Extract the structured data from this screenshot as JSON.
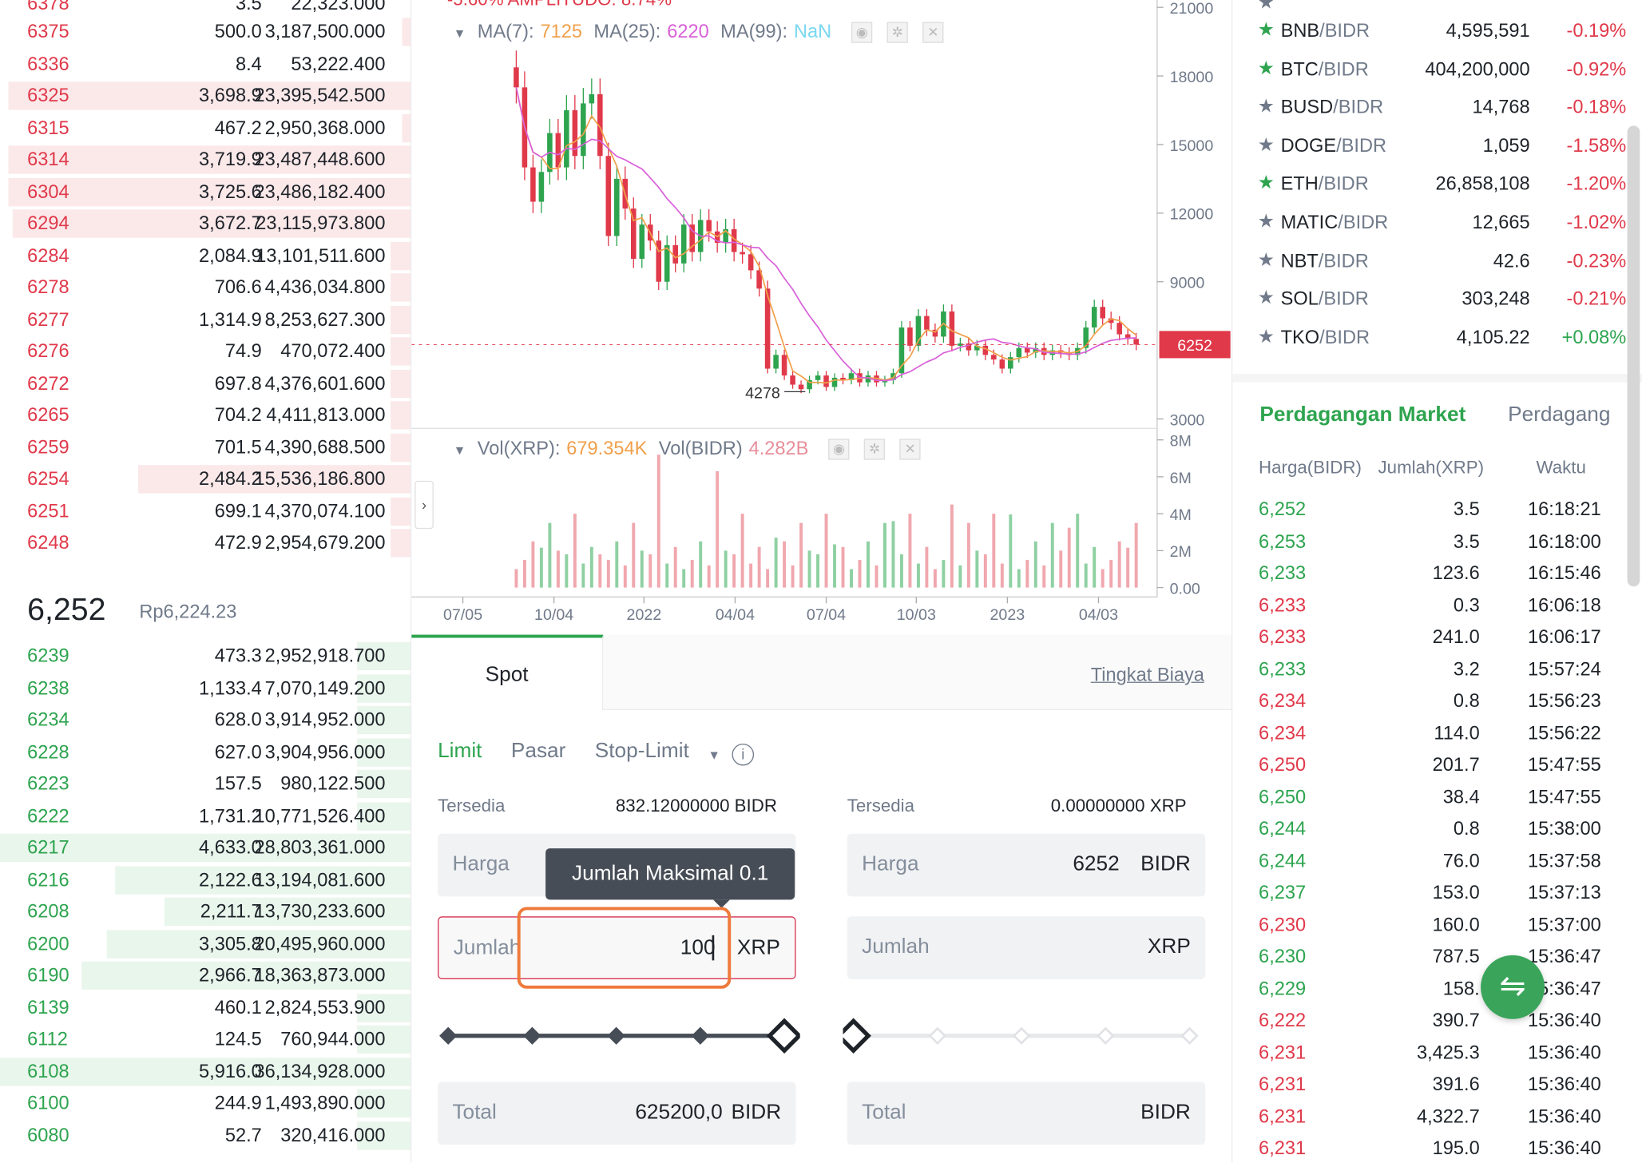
{
  "colors": {
    "up": "#2ea44f",
    "down": "#e0394a",
    "accent": "#2ea44f",
    "ma7": "#f0a04b",
    "ma25": "#d960d9",
    "ma99": "#7ad7f0"
  },
  "orderbook": {
    "top_cut": {
      "price": "6378",
      "amount": "3.5",
      "total": "22,323.000"
    },
    "asks": [
      {
        "price": "6375",
        "amount": "500.0",
        "total": "3,187,500.000",
        "depth": 0.02
      },
      {
        "price": "6336",
        "amount": "8.4",
        "total": "53,222.400",
        "depth": 0.0
      },
      {
        "price": "6325",
        "amount": "3,698.9",
        "total": "23,395,542.500",
        "depth": 0.99
      },
      {
        "price": "6315",
        "amount": "467.2",
        "total": "2,950,368.000",
        "depth": 0.02
      },
      {
        "price": "6314",
        "amount": "3,719.9",
        "total": "23,487,448.600",
        "depth": 0.99
      },
      {
        "price": "6304",
        "amount": "3,725.6",
        "total": "23,486,182.400",
        "depth": 0.99
      },
      {
        "price": "6294",
        "amount": "3,672.7",
        "total": "23,115,973.800",
        "depth": 0.98
      },
      {
        "price": "6284",
        "amount": "2,084.9",
        "total": "13,101,511.600",
        "depth": 0.05
      },
      {
        "price": "6278",
        "amount": "706.6",
        "total": "4,436,034.800",
        "depth": 0.05
      },
      {
        "price": "6277",
        "amount": "1,314.9",
        "total": "8,253,627.300",
        "depth": 0.05
      },
      {
        "price": "6276",
        "amount": "74.9",
        "total": "470,072.400",
        "depth": 0.05
      },
      {
        "price": "6272",
        "amount": "697.8",
        "total": "4,376,601.600",
        "depth": 0.05
      },
      {
        "price": "6265",
        "amount": "704.2",
        "total": "4,411,813.000",
        "depth": 0.05
      },
      {
        "price": "6259",
        "amount": "701.5",
        "total": "4,390,688.500",
        "depth": 0.05
      },
      {
        "price": "6254",
        "amount": "2,484.2",
        "total": "15,536,186.800",
        "depth": 0.67
      },
      {
        "price": "6251",
        "amount": "699.1",
        "total": "4,370,074.100",
        "depth": 0.05
      },
      {
        "price": "6248",
        "amount": "472.9",
        "total": "2,954,679.200",
        "depth": 0.05
      }
    ],
    "last_price": "6,252",
    "last_price_rp": "Rp6,224.23",
    "bids": [
      {
        "price": "6239",
        "amount": "473.3",
        "total": "2,952,918.700",
        "depth": 0.13
      },
      {
        "price": "6238",
        "amount": "1,133.4",
        "total": "7,070,149.200",
        "depth": 0.13
      },
      {
        "price": "6234",
        "amount": "628.0",
        "total": "3,914,952.000",
        "depth": 0.13
      },
      {
        "price": "6228",
        "amount": "627.0",
        "total": "3,904,956.000",
        "depth": 0.13
      },
      {
        "price": "6223",
        "amount": "157.5",
        "total": "980,122.500",
        "depth": 0.13
      },
      {
        "price": "6222",
        "amount": "1,731.2",
        "total": "10,771,526.400",
        "depth": 0.13
      },
      {
        "price": "6217",
        "amount": "4,633.0",
        "total": "28,803,361.000",
        "depth": 1.0
      },
      {
        "price": "6216",
        "amount": "2,122.6",
        "total": "13,194,081.600",
        "depth": 0.72
      },
      {
        "price": "6208",
        "amount": "2,211.7",
        "total": "13,730,233.600",
        "depth": 0.6
      },
      {
        "price": "6200",
        "amount": "3,305.8",
        "total": "20,495,960.000",
        "depth": 0.74
      },
      {
        "price": "6190",
        "amount": "2,966.7",
        "total": "18,363,873.000",
        "depth": 0.8
      },
      {
        "price": "6139",
        "amount": "460.1",
        "total": "2,824,553.900",
        "depth": 0.13
      },
      {
        "price": "6112",
        "amount": "124.5",
        "total": "760,944.000",
        "depth": 0.13
      },
      {
        "price": "6108",
        "amount": "5,916.0",
        "total": "36,134,928.000",
        "depth": 1.0
      },
      {
        "price": "6100",
        "amount": "244.9",
        "total": "1,493,890.000",
        "depth": 0.13
      },
      {
        "price": "6080",
        "amount": "52.7",
        "total": "320,416.000",
        "depth": 0.13
      }
    ]
  },
  "chart": {
    "header_cut": "-5.60%  AMPLITUDO: 8.74%",
    "ma7_label": "MA(7):",
    "ma7_value": "7125",
    "ma25_label": "MA(25):",
    "ma25_value": "6220",
    "ma99_label": "MA(99):",
    "ma99_value": "NaN",
    "vol_xrp_label": "Vol(XRP):",
    "vol_xrp_value": "679.354K",
    "vol_bidr_label": "Vol(BIDR)",
    "vol_bidr_value": "4.282B",
    "current_price_tag": "6252",
    "low_marker": "4278",
    "price_axis": [
      "21000",
      "18000",
      "15000",
      "12000",
      "9000",
      "3000"
    ],
    "vol_axis": [
      "8M",
      "6M",
      "4M",
      "2M",
      "0.00"
    ],
    "date_axis": [
      "07/05",
      "10/04",
      "2022",
      "04/04",
      "07/04",
      "10/03",
      "2023",
      "04/03"
    ],
    "icons": [
      "eye-icon",
      "gear-icon",
      "close-icon"
    ]
  },
  "trade_form": {
    "tab_spot": "Spot",
    "fee_link": "Tingkat Biaya",
    "order_types": [
      "Limit",
      "Pasar",
      "Stop-Limit"
    ],
    "active_order_type": "Limit",
    "buy": {
      "available_label": "Tersedia",
      "available_value": "832.12000000 BIDR",
      "price_label": "Harga",
      "price_value": "",
      "amount_label": "Jumlah",
      "amount_value": "100",
      "amount_unit": "XRP",
      "slider_percent": 100,
      "total_label": "Total",
      "total_value": "625200,0",
      "total_unit": "BIDR"
    },
    "sell": {
      "available_label": "Tersedia",
      "available_value": "0.00000000 XRP",
      "price_label": "Harga",
      "price_value": "6252",
      "price_unit": "BIDR",
      "amount_label": "Jumlah",
      "amount_value": "",
      "amount_unit": "XRP",
      "slider_percent": 0,
      "total_label": "Total",
      "total_value": "",
      "total_unit": "BIDR"
    },
    "tooltip": "Jumlah Maksimal 0.1"
  },
  "market": {
    "pairs": [
      {
        "base": "BNB",
        "quote": "/BIDR",
        "price": "4,595,591",
        "change": "-0.19%",
        "fav": true
      },
      {
        "base": "BTC",
        "quote": "/BIDR",
        "price": "404,200,000",
        "change": "-0.92%",
        "fav": true
      },
      {
        "base": "BUSD",
        "quote": "/BIDR",
        "price": "14,768",
        "change": "-0.18%",
        "fav": false
      },
      {
        "base": "DOGE",
        "quote": "/BIDR",
        "price": "1,059",
        "change": "-1.58%",
        "fav": false
      },
      {
        "base": "ETH",
        "quote": "/BIDR",
        "price": "26,858,108",
        "change": "-1.20%",
        "fav": true
      },
      {
        "base": "MATIC",
        "quote": "/BIDR",
        "price": "12,665",
        "change": "-1.02%",
        "fav": false
      },
      {
        "base": "NBT",
        "quote": "/BIDR",
        "price": "42.6",
        "change": "-0.23%",
        "fav": false
      },
      {
        "base": "SOL",
        "quote": "/BIDR",
        "price": "303,248",
        "change": "-0.21%",
        "fav": false
      },
      {
        "base": "TKO",
        "quote": "/BIDR",
        "price": "4,105.22",
        "change": "+0.08%",
        "fav": false
      }
    ],
    "tab_market_trades": "Perdagangan Market",
    "tab_my_trades": "Perdagang",
    "headers": {
      "price": "Harga(BIDR)",
      "amount": "Jumlah(XRP)",
      "time": "Waktu"
    },
    "trades": [
      {
        "price": "6,252",
        "amount": "3.5",
        "time": "16:18:21",
        "side": "up"
      },
      {
        "price": "6,253",
        "amount": "3.5",
        "time": "16:18:00",
        "side": "up"
      },
      {
        "price": "6,233",
        "amount": "123.6",
        "time": "16:15:46",
        "side": "up"
      },
      {
        "price": "6,233",
        "amount": "0.3",
        "time": "16:06:18",
        "side": "down"
      },
      {
        "price": "6,233",
        "amount": "241.0",
        "time": "16:06:17",
        "side": "down"
      },
      {
        "price": "6,233",
        "amount": "3.2",
        "time": "15:57:24",
        "side": "up"
      },
      {
        "price": "6,234",
        "amount": "0.8",
        "time": "15:56:23",
        "side": "down"
      },
      {
        "price": "6,234",
        "amount": "114.0",
        "time": "15:56:22",
        "side": "down"
      },
      {
        "price": "6,250",
        "amount": "201.7",
        "time": "15:47:55",
        "side": "down"
      },
      {
        "price": "6,250",
        "amount": "38.4",
        "time": "15:47:55",
        "side": "up"
      },
      {
        "price": "6,244",
        "amount": "0.8",
        "time": "15:38:00",
        "side": "up"
      },
      {
        "price": "6,244",
        "amount": "76.0",
        "time": "15:37:58",
        "side": "up"
      },
      {
        "price": "6,237",
        "amount": "153.0",
        "time": "15:37:13",
        "side": "up"
      },
      {
        "price": "6,230",
        "amount": "160.0",
        "time": "15:37:00",
        "side": "down"
      },
      {
        "price": "6,230",
        "amount": "787.5",
        "time": "15:36:47",
        "side": "up"
      },
      {
        "price": "6,229",
        "amount": "158.",
        "time": "15:36:47",
        "side": "up"
      },
      {
        "price": "6,222",
        "amount": "390.7",
        "time": "15:36:40",
        "side": "down"
      },
      {
        "price": "6,231",
        "amount": "3,425.3",
        "time": "15:36:40",
        "side": "down"
      },
      {
        "price": "6,231",
        "amount": "391.6",
        "time": "15:36:40",
        "side": "down"
      },
      {
        "price": "6,231",
        "amount": "4,322.7",
        "time": "15:36:40",
        "side": "down"
      },
      {
        "price": "6,231",
        "amount": "195.0",
        "time": "15:36:40",
        "side": "down"
      }
    ]
  }
}
